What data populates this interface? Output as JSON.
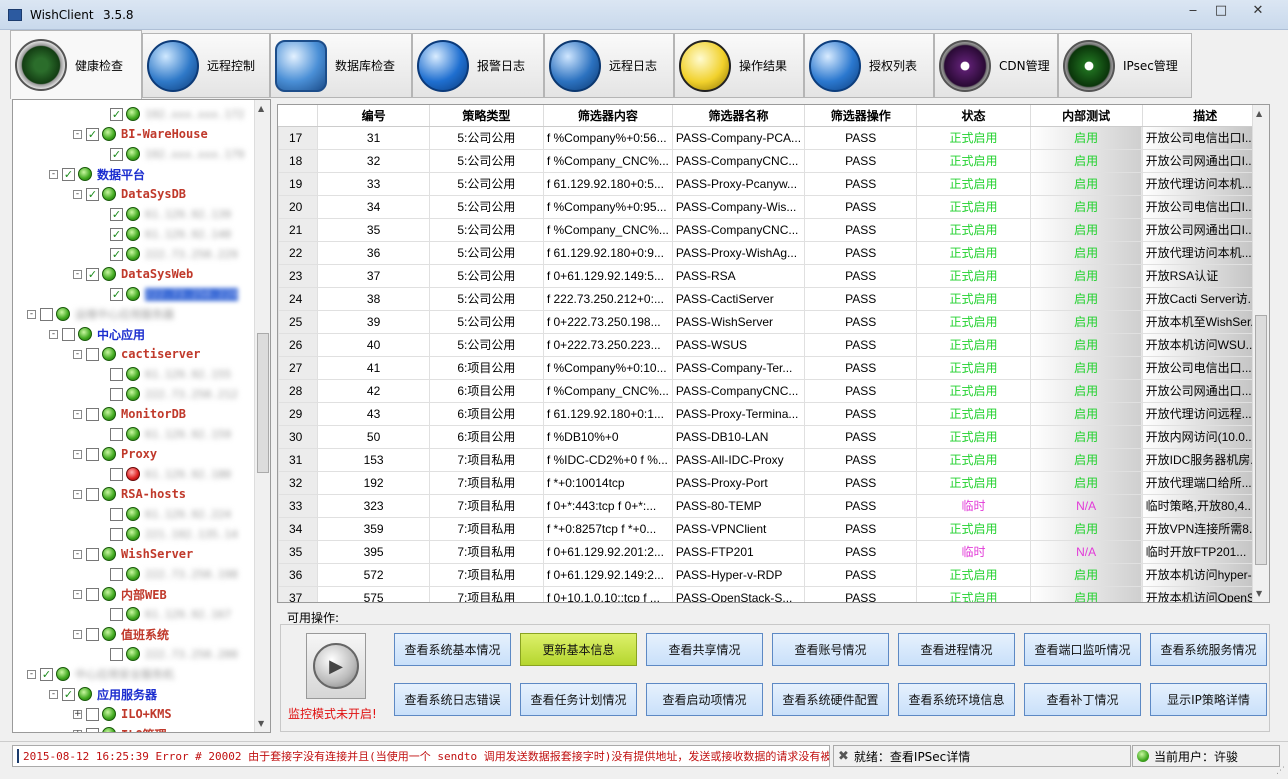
{
  "window": {
    "app_name": "WishClient",
    "version": "3.5.8",
    "minimize": "‒",
    "maximize": "□",
    "close": "✕"
  },
  "tabs": [
    {
      "label": "健康检查",
      "icon": "radar-icon",
      "active": true
    },
    {
      "label": "远程控制",
      "icon": "globe-icon"
    },
    {
      "label": "数据库检查",
      "icon": "database-globe-icon"
    },
    {
      "label": "报警日志",
      "icon": "megaphone-icon"
    },
    {
      "label": "远程日志",
      "icon": "wrench-globe-icon"
    },
    {
      "label": "操作结果",
      "icon": "dashboard-icon"
    },
    {
      "label": "授权列表",
      "icon": "network-globe-icon"
    },
    {
      "label": "CDN管理",
      "icon": "yinyang-purple-icon"
    },
    {
      "label": "IPsec管理",
      "icon": "yinyang-green-icon"
    }
  ],
  "tree": [
    {
      "label": "192.xxx.xxx.172",
      "blur": true,
      "level": 3,
      "checked": true
    },
    {
      "label": "BI-WareHouse",
      "style": "red",
      "level": 2,
      "checked": true,
      "expander": "-"
    },
    {
      "label": "192.xxx.xxx.179",
      "blur": true,
      "level": 3,
      "checked": true
    },
    {
      "label": "数据平台",
      "style": "blue",
      "level": 1,
      "checked": true,
      "expander": "-"
    },
    {
      "label": "DataSysDB",
      "style": "red",
      "level": 2,
      "checked": true,
      "expander": "-"
    },
    {
      "label": "61.129.92.139",
      "blur": true,
      "level": 3,
      "checked": true
    },
    {
      "label": "61.129.92.140",
      "blur": true,
      "level": 3,
      "checked": true
    },
    {
      "label": "222.73.250.229",
      "blur": true,
      "level": 3,
      "checked": true
    },
    {
      "label": "DataSysWeb",
      "style": "red",
      "level": 2,
      "checked": true,
      "expander": "-"
    },
    {
      "label": "222.73.250.228",
      "blur": true,
      "selected": true,
      "level": 3,
      "checked": true
    },
    {
      "label": "运维中心应用服务器",
      "blur": true,
      "level": 0,
      "checked": false,
      "expander": "-"
    },
    {
      "label": "中心应用",
      "style": "blue",
      "level": 1,
      "checked": false,
      "expander": "-"
    },
    {
      "label": "cactiserver",
      "style": "red",
      "level": 2,
      "checked": false,
      "expander": "-"
    },
    {
      "label": "61.129.92.155",
      "blur": true,
      "level": 3,
      "checked": false
    },
    {
      "label": "222.73.250.212",
      "blur": true,
      "level": 3,
      "checked": false
    },
    {
      "label": "MonitorDB",
      "style": "red",
      "level": 2,
      "checked": false,
      "expander": "-"
    },
    {
      "label": "61.129.92.159",
      "blur": true,
      "level": 3,
      "checked": false
    },
    {
      "label": "Proxy",
      "style": "red",
      "level": 2,
      "checked": false,
      "expander": "-"
    },
    {
      "label": "61.129.92.180",
      "blur": true,
      "level": 3,
      "checked": false,
      "red_icon": true
    },
    {
      "label": "RSA-hosts",
      "style": "red",
      "level": 2,
      "checked": false,
      "expander": "-"
    },
    {
      "label": "61.129.92.224",
      "blur": true,
      "level": 3,
      "checked": false
    },
    {
      "label": "221.192.135.14",
      "blur": true,
      "level": 3,
      "checked": false
    },
    {
      "label": "WishServer",
      "style": "red",
      "level": 2,
      "checked": false,
      "expander": "-"
    },
    {
      "label": "222.73.250.198",
      "blur": true,
      "level": 3,
      "checked": false
    },
    {
      "label": "内部WEB",
      "style": "red",
      "level": 2,
      "checked": false,
      "expander": "-"
    },
    {
      "label": "61.129.92.167",
      "blur": true,
      "level": 3,
      "checked": false
    },
    {
      "label": "值班系统",
      "style": "red",
      "level": 2,
      "checked": false,
      "expander": "-"
    },
    {
      "label": "222.73.250.200",
      "blur": true,
      "level": 3,
      "checked": false
    },
    {
      "label": "中心应用安全服务机",
      "blur": true,
      "level": 0,
      "checked": true,
      "expander": "-"
    },
    {
      "label": "应用服务器",
      "style": "blue",
      "level": 1,
      "checked": true,
      "expander": "-"
    },
    {
      "label": "ILO+KMS",
      "style": "red",
      "level": 2,
      "checked": false,
      "expander": "+"
    },
    {
      "label": "ILO管理",
      "style": "red",
      "level": 2,
      "checked": false,
      "expander": "+"
    }
  ],
  "grid": {
    "columns": [
      "",
      "编号",
      "策略类型",
      "筛选器内容",
      "筛选器名称",
      "筛选器操作",
      "状态",
      "内部测试",
      "描述"
    ],
    "rows": [
      [
        "17",
        "31",
        "5:公司公用",
        "f %Company%+0:56...",
        "PASS-Company-PCA...",
        "PASS",
        "正式启用",
        "启用",
        "开放公司电信出口I..."
      ],
      [
        "18",
        "32",
        "5:公司公用",
        "f %Company_CNC%...",
        "PASS-CompanyCNC...",
        "PASS",
        "正式启用",
        "启用",
        "开放公司网通出口I..."
      ],
      [
        "19",
        "33",
        "5:公司公用",
        "f 61.129.92.180+0:5...",
        "PASS-Proxy-Pcanyw...",
        "PASS",
        "正式启用",
        "启用",
        "开放代理访问本机..."
      ],
      [
        "20",
        "34",
        "5:公司公用",
        "f %Company%+0:95...",
        "PASS-Company-Wis...",
        "PASS",
        "正式启用",
        "启用",
        "开放公司电信出口I..."
      ],
      [
        "21",
        "35",
        "5:公司公用",
        "f %Company_CNC%...",
        "PASS-CompanyCNC...",
        "PASS",
        "正式启用",
        "启用",
        "开放公司网通出口I..."
      ],
      [
        "22",
        "36",
        "5:公司公用",
        "f 61.129.92.180+0:9...",
        "PASS-Proxy-WishAg...",
        "PASS",
        "正式启用",
        "启用",
        "开放代理访问本机..."
      ],
      [
        "23",
        "37",
        "5:公司公用",
        "f 0+61.129.92.149:5...",
        "PASS-RSA",
        "PASS",
        "正式启用",
        "启用",
        "开放RSA认证"
      ],
      [
        "24",
        "38",
        "5:公司公用",
        "f 222.73.250.212+0:...",
        "PASS-CactiServer",
        "PASS",
        "正式启用",
        "启用",
        "开放Cacti Server访..."
      ],
      [
        "25",
        "39",
        "5:公司公用",
        "f 0+222.73.250.198...",
        "PASS-WishServer",
        "PASS",
        "正式启用",
        "启用",
        "开放本机至WishSer..."
      ],
      [
        "26",
        "40",
        "5:公司公用",
        "f 0+222.73.250.223...",
        "PASS-WSUS",
        "PASS",
        "正式启用",
        "启用",
        "开放本机访问WSU..."
      ],
      [
        "27",
        "41",
        "6:项目公用",
        "f %Company%+0:10...",
        "PASS-Company-Ter...",
        "PASS",
        "正式启用",
        "启用",
        "开放公司电信出口..."
      ],
      [
        "28",
        "42",
        "6:项目公用",
        "f %Company_CNC%...",
        "PASS-CompanyCNC...",
        "PASS",
        "正式启用",
        "启用",
        "开放公司网通出口..."
      ],
      [
        "29",
        "43",
        "6:项目公用",
        "f 61.129.92.180+0:1...",
        "PASS-Proxy-Termina...",
        "PASS",
        "正式启用",
        "启用",
        "开放代理访问远程..."
      ],
      [
        "30",
        "50",
        "6:项目公用",
        "f %DB10%+0",
        "PASS-DB10-LAN",
        "PASS",
        "正式启用",
        "启用",
        "开放内网访问(10.0...."
      ],
      [
        "31",
        "153",
        "7:项目私用",
        "f %IDC-CD2%+0 f %...",
        "PASS-All-IDC-Proxy",
        "PASS",
        "正式启用",
        "启用",
        "开放IDC服务器机房..."
      ],
      [
        "32",
        "192",
        "7:项目私用",
        "f *+0:10014tcp",
        "PASS-Proxy-Port",
        "PASS",
        "正式启用",
        "启用",
        "开放代理端口给所..."
      ],
      [
        "33",
        "323",
        "7:项目私用",
        "f 0+*:443:tcp f 0+*:...",
        "PASS-80-TEMP",
        "PASS",
        "临时",
        "N/A",
        "临时策略,开放80,4..."
      ],
      [
        "34",
        "359",
        "7:项目私用",
        "f *+0:8257tcp f *+0...",
        "PASS-VPNClient",
        "PASS",
        "正式启用",
        "启用",
        "开放VPN连接所需8..."
      ],
      [
        "35",
        "395",
        "7:项目私用",
        "f 0+61.129.92.201:2...",
        "PASS-FTP201",
        "PASS",
        "临时",
        "N/A",
        "临时开放FTP201..."
      ],
      [
        "36",
        "572",
        "7:项目私用",
        "f 0+61.129.92.149:2...",
        "PASS-Hyper-v-RDP",
        "PASS",
        "正式启用",
        "启用",
        "开放本机访问hyper-..."
      ],
      [
        "37",
        "575",
        "7:项目私用",
        "f 0+10.1.0.10::tcp f ...",
        "PASS-OpenStack-S...",
        "PASS",
        "正式启用",
        "启用",
        "开放本机访问OpenS..."
      ]
    ]
  },
  "ops": {
    "label": "可用操作:",
    "monitor_status": "监控模式未开启!",
    "buttons": [
      "查看系统基本情况",
      "更新基本信息",
      "查看共享情况",
      "查看账号情况",
      "查看进程情况",
      "查看端口监听情况",
      "查看系统服务情况",
      "查看系统日志错误",
      "查看任务计划情况",
      "查看启动项情况",
      "查看系统硬件配置",
      "查看系统环境信息",
      "查看补丁情况",
      "显示IP策略详情"
    ]
  },
  "status": {
    "error": "2015-08-12 16:25:39  Error # 20002  由于套接字没有连接并且(当使用一个 sendto 调用发送数据报套接字时)没有提供地址，发送或接收数据的请求没有被接受。",
    "ready": "就绪：查看IPSec详情",
    "user": "当前用户：许骏"
  },
  "colors": {
    "status_on": "#22d12e",
    "status_temp": "#e23ad8",
    "highlight_button": "#c4de3c",
    "error_text": "#c01010"
  }
}
